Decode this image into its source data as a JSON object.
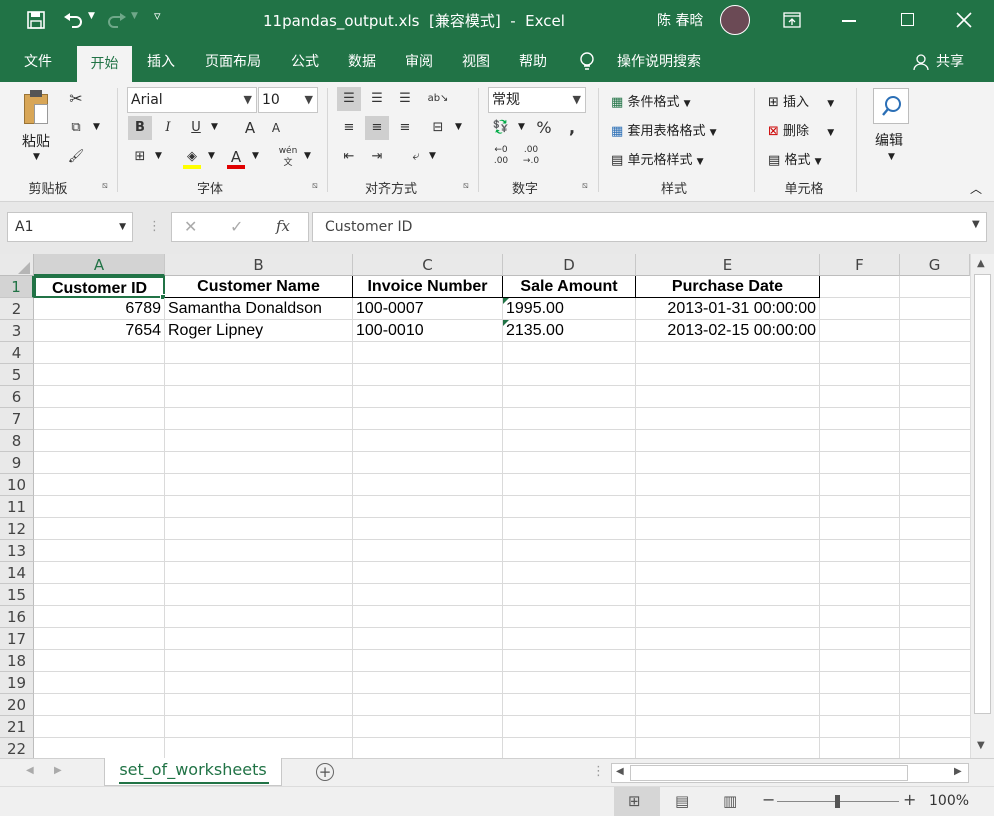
{
  "title_bar": {
    "title": "11pandas_output.xls  [兼容模式]  -  Excel",
    "user": "陈 春晗"
  },
  "tabs": [
    "文件",
    "开始",
    "插入",
    "页面布局",
    "公式",
    "数据",
    "审阅",
    "视图",
    "帮助"
  ],
  "tell_me": "操作说明搜索",
  "share": "共享",
  "ribbon": {
    "clipboard": {
      "paste": "粘贴",
      "label": "剪贴板"
    },
    "font": {
      "name": "Arial",
      "size": "10",
      "bold": "B",
      "italic": "I",
      "underline": "U",
      "grow": "A",
      "shrink": "A",
      "font_color": "A",
      "phonetic": "wén",
      "label": "字体"
    },
    "alignment": {
      "label": "对齐方式"
    },
    "number": {
      "format": "常规",
      "percent": "%",
      "comma": ",",
      "label": "数字"
    },
    "styles": {
      "conditional": "条件格式",
      "table": "套用表格格式",
      "cell": "单元格样式",
      "label": "样式"
    },
    "cells": {
      "insert": "插入",
      "delete": "删除",
      "format": "格式",
      "label": "单元格"
    },
    "editing": {
      "label": "编辑"
    }
  },
  "formula_bar": {
    "name_box": "A1",
    "formula": "Customer ID",
    "fx": "fx"
  },
  "columns": [
    "A",
    "B",
    "C",
    "D",
    "E",
    "F",
    "G"
  ],
  "rows": [
    "1",
    "2",
    "3",
    "4",
    "5",
    "6",
    "7",
    "8",
    "9",
    "10",
    "11",
    "12",
    "13",
    "14",
    "15",
    "16",
    "17",
    "18",
    "19",
    "20",
    "21",
    "22"
  ],
  "cells": {
    "header": [
      "Customer ID",
      "Customer Name",
      "Invoice Number",
      "Sale Amount",
      "Purchase Date"
    ],
    "row2": [
      "6789",
      "Samantha Donaldson",
      "100-0007",
      "1995.00",
      "2013-01-31 00:00:00"
    ],
    "row3": [
      "7654",
      "Roger Lipney",
      "100-0010",
      "2135.00",
      "2013-02-15 00:00:00"
    ]
  },
  "sheet_tab": "set_of_worksheets",
  "zoom": "100%",
  "colors": {
    "excel_green": "#217346",
    "ribbon_bg": "#f3f3f3"
  }
}
